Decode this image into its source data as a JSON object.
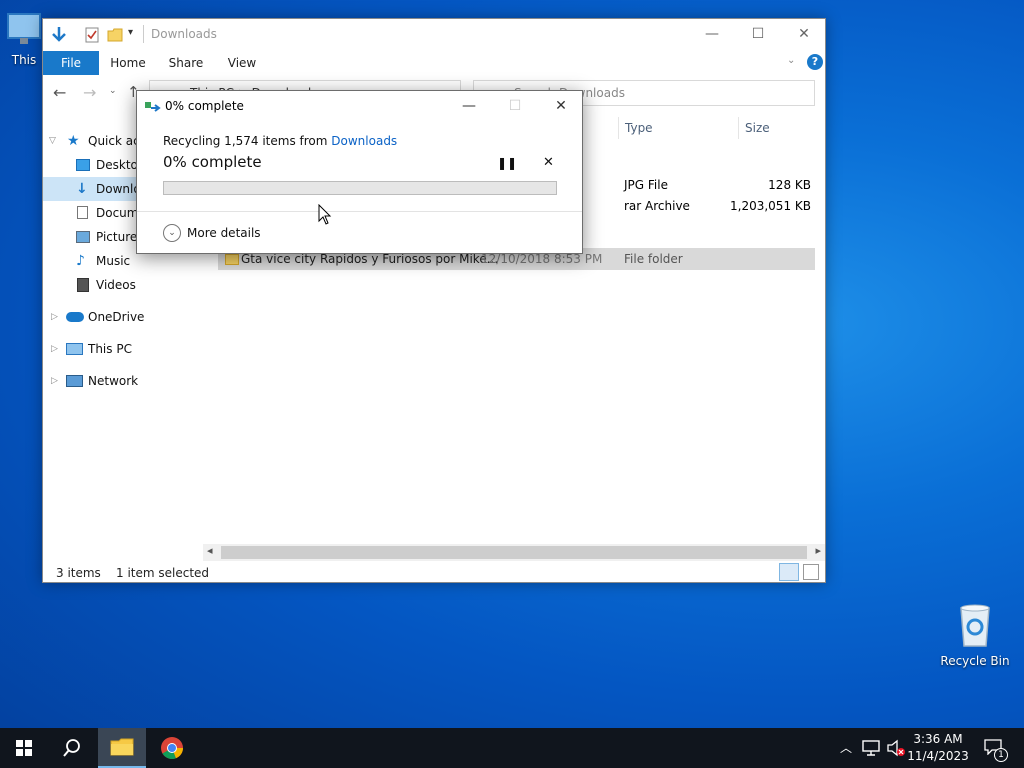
{
  "desktop": {
    "this_pc_label": "This",
    "recycle_bin_label": "Recycle Bin"
  },
  "explorer": {
    "title": "Downloads",
    "ribbon_tabs": [
      "File",
      "Home",
      "Share",
      "View"
    ],
    "search_placeholder": "Search Downloads",
    "address_visible": "This PC  >  Downloads",
    "sidebar": {
      "quick_access": "Quick acc",
      "desktop": "Desktop",
      "downloads": "Downlo",
      "documents": "Docume",
      "pictures": "Pictures",
      "music": "Music",
      "videos": "Videos",
      "onedrive": "OneDrive",
      "this_pc": "This PC",
      "network": "Network"
    },
    "columns": {
      "type": "Type",
      "size": "Size"
    },
    "rows": [
      {
        "name": "",
        "date": "",
        "type": "JPG File",
        "size": "128 KB"
      },
      {
        "name": "",
        "date": "",
        "type": "rar Archive",
        "size": "1,203,051 KB"
      },
      {
        "name": "Gta vice city Rapidos y Furiosos por Mike...",
        "date": "12/10/2018 8:53 PM",
        "type": "File folder",
        "size": ""
      }
    ],
    "status": {
      "items": "3 items",
      "selected": "1 item selected"
    }
  },
  "dialog": {
    "title": "0% complete",
    "recycling_prefix": "Recycling 1,574 items from ",
    "source_link": "Downloads",
    "progress_text": "0% complete",
    "progress_percent": 0,
    "more_details": "More details"
  },
  "taskbar": {
    "time": "3:36 AM",
    "date": "11/4/2023",
    "notification_count": "1"
  },
  "colors": {
    "accent": "#1979ca",
    "link": "#0b62c6",
    "progress": "#06b025"
  }
}
